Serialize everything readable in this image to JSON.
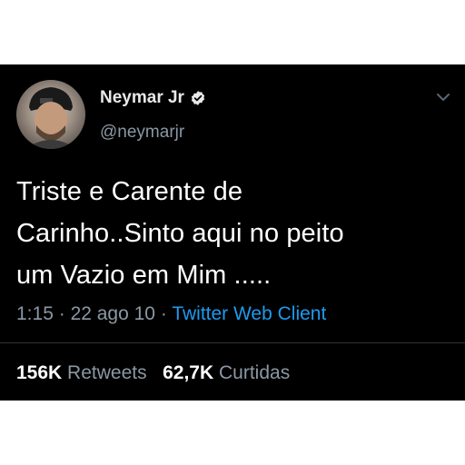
{
  "profile": {
    "display_name": "Neymar Jr",
    "handle": "@neymarjr",
    "avatar_icon": "profile-photo",
    "verified_icon": "verified-badge-icon"
  },
  "tweet": {
    "line1": "Triste e Carente de",
    "line2": "Carinho..Sinto aqui no peito",
    "line3": "um Vazio em Mim ....."
  },
  "meta": {
    "time": "1:15",
    "date": "22 ago 10",
    "separator": "·",
    "source": "Twitter Web Client"
  },
  "stats": {
    "retweets_count": "156K",
    "retweets_label": "Retweets",
    "likes_count": "62,7K",
    "likes_label": "Curtidas"
  },
  "colors": {
    "background": "#000000",
    "primary_text": "#e7e9ea",
    "secondary_text": "#8b98a5",
    "link": "#1d9bf0"
  }
}
